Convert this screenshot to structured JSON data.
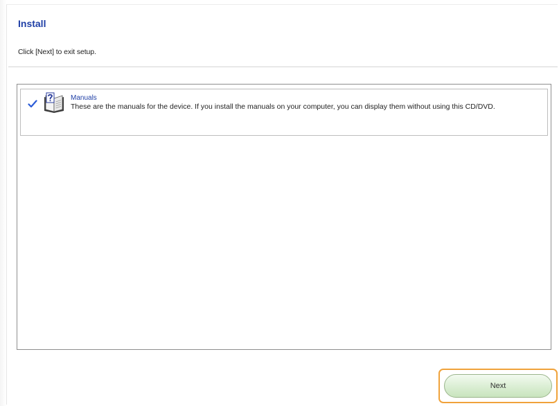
{
  "page": {
    "title": "Install",
    "instruction": "Click [Next] to exit setup."
  },
  "items": [
    {
      "name": "Manuals",
      "description": "These are the manuals for the device. If you install the manuals on your computer, you can display them without using this CD/DVD.",
      "checked": true
    }
  ],
  "footer": {
    "next_label": "Next"
  },
  "colors": {
    "accent_text": "#1f3fa6",
    "highlight": "#f0a23a",
    "button_green": "#dcefd5"
  },
  "icons": {
    "check": "check-icon",
    "manual": "manual-book-icon"
  }
}
